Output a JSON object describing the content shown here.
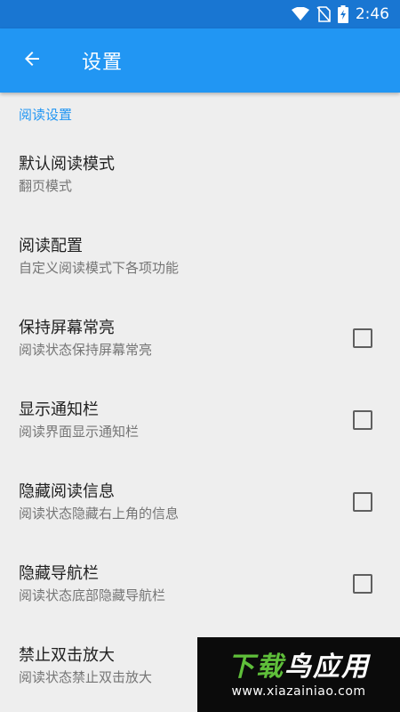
{
  "status_bar": {
    "time": "2:46",
    "icons": [
      "wifi-icon",
      "no-sim-icon",
      "battery-charging-icon"
    ]
  },
  "app_bar": {
    "back_icon": "arrow-left-icon",
    "title": "设置"
  },
  "section": {
    "title": "阅读设置"
  },
  "preferences": [
    {
      "title": "默认阅读模式",
      "summary": "翻页模式",
      "has_checkbox": false
    },
    {
      "title": "阅读配置",
      "summary": "自定义阅读模式下各项功能",
      "has_checkbox": false
    },
    {
      "title": "保持屏幕常亮",
      "summary": "阅读状态保持屏幕常亮",
      "has_checkbox": true,
      "checked": false
    },
    {
      "title": "显示通知栏",
      "summary": "阅读界面显示通知栏",
      "has_checkbox": true,
      "checked": false
    },
    {
      "title": "隐藏阅读信息",
      "summary": "阅读状态隐藏右上角的信息",
      "has_checkbox": true,
      "checked": false
    },
    {
      "title": "隐藏导航栏",
      "summary": "阅读状态底部隐藏导航栏",
      "has_checkbox": true,
      "checked": false
    },
    {
      "title": "禁止双击放大",
      "summary": "阅读状态禁止双击放大",
      "has_checkbox": false
    }
  ],
  "watermark": {
    "text_part1": "下载",
    "text_part2": "鸟应用",
    "url": "www.xiazainiao.com"
  },
  "colors": {
    "status_bar": "#1976d2",
    "app_bar": "#2196f3",
    "accent": "#2196f3",
    "background": "#eeeeee"
  }
}
